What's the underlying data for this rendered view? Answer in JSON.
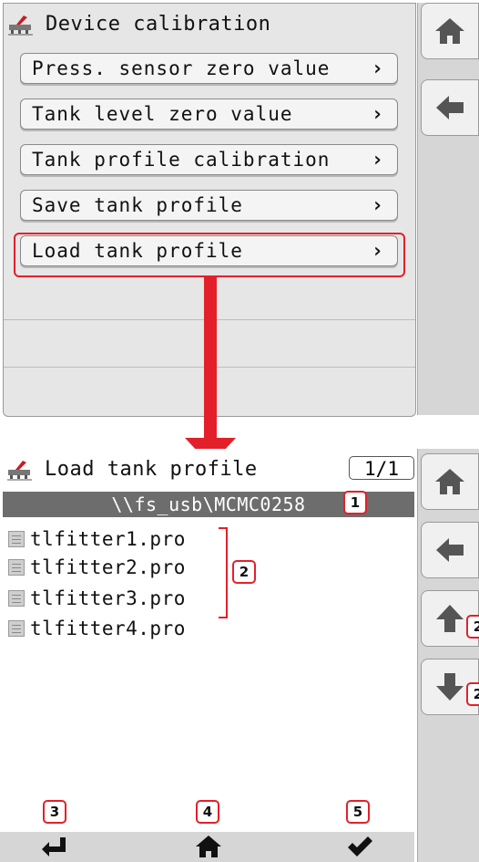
{
  "screen1": {
    "title": "Device calibration",
    "menu": [
      {
        "label": "Press. sensor zero value",
        "chevron": "›"
      },
      {
        "label": "Tank level zero value",
        "chevron": "›"
      },
      {
        "label": "Tank profile calibration",
        "chevron": "›"
      },
      {
        "label": "Save tank profile",
        "chevron": "›"
      },
      {
        "label": "Load tank profile",
        "chevron": "›"
      }
    ],
    "sidebar": [
      "home-icon",
      "back-icon"
    ]
  },
  "screen2": {
    "title": "Load tank profile",
    "page_indicator": "1/1",
    "path": "\\\\fs_usb\\MCMC0258",
    "files": [
      "tlfitter1.pro",
      "tlfitter2.pro",
      "tlfitter3.pro",
      "tlfitter4.pro"
    ],
    "sidebar": [
      "home-icon",
      "back-icon",
      "arrow-up-icon",
      "arrow-down-icon"
    ],
    "bottom_bar": [
      "return-icon",
      "home-icon",
      "check-icon"
    ]
  },
  "callouts": {
    "path": "1",
    "files": "2",
    "scroll_up": "2",
    "scroll_down": "2",
    "return": "3",
    "home": "4",
    "confirm": "5"
  },
  "colors": {
    "highlight": "#e3202a",
    "path_bar": "#6d6d6d",
    "panel": "#e6e6e6",
    "sidebar": "#d6d6d6"
  }
}
